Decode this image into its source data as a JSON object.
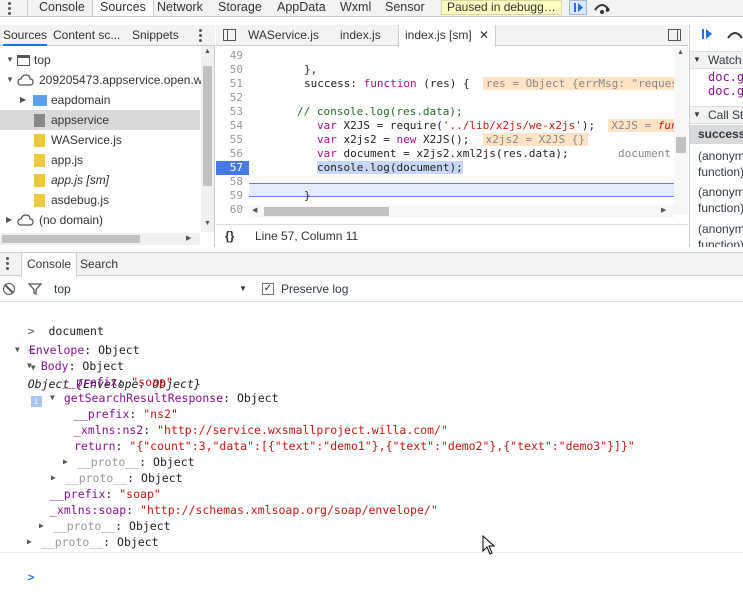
{
  "top_tabs": [
    "Console",
    "Sources",
    "Network",
    "Storage",
    "AppData",
    "Wxml",
    "Sensor"
  ],
  "active_top_tab": "Sources",
  "paused_label": "Paused in debugg…",
  "navigator": {
    "tabs": [
      "Sources",
      "Content sc...",
      "Snippets"
    ],
    "tree": [
      {
        "label": "top",
        "icon": "frame-icon"
      },
      {
        "label": "209205473.appservice.open.w",
        "icon": "cloud-icon"
      },
      {
        "label": "eapdomain",
        "icon": "folder-icon"
      },
      {
        "label": "appservice",
        "icon": "file-icon"
      },
      {
        "label": "WAService.js",
        "icon": "file-icon"
      },
      {
        "label": "app.js",
        "icon": "file-icon"
      },
      {
        "label": "app.js [sm]",
        "icon": "file-icon"
      },
      {
        "label": "asdebug.js",
        "icon": "file-icon"
      },
      {
        "label": "(no domain)",
        "icon": "cloud-icon"
      }
    ]
  },
  "editor": {
    "tabs": [
      "WAService.js",
      "index.js",
      "index.js [sm]"
    ],
    "active_tab": "index.js [sm]",
    "line_numbers": [
      "49",
      "50",
      "51",
      "52",
      "53",
      "54",
      "55",
      "56",
      "57",
      "58",
      "59",
      "60"
    ],
    "current_line": "57",
    "code": {
      "l50": "},",
      "l51_a": "success: ",
      "l51_kw": "function",
      "l51_b": " (res) {",
      "l51_val": "res = Object {errMsg: \"reques",
      "l53": "// console.log(res.data);",
      "l54_kw": "var",
      "l54_a": " X2JS = require(",
      "l54_str": "'../lib/x2js/we-x2js'",
      "l54_b": ");",
      "l54_val_a": "X2JS = ",
      "l54_val_b": "fun",
      "l55_kw": "var",
      "l55_a": " x2js2 = ",
      "l55_kw2": "new",
      "l55_b": " X2JS();",
      "l55_val": "x2js2 = X2JS {}",
      "l56_kw": "var",
      "l56_a": " document = x2js2.xml2js(res.data);",
      "l56_val": "document",
      "l57": "console.log(document);",
      "l59": "}"
    },
    "status": "Line 57, Column 11",
    "status_icon": "{}"
  },
  "debugger_sidebar": {
    "watch_label": "Watch",
    "watch_items": [
      "doc.ge",
      "doc.ge"
    ],
    "call_stack_label": "Call Sta",
    "frames": [
      "success",
      "(anonym",
      "function)",
      "(anonym",
      "function)",
      "(anonym",
      "function)"
    ]
  },
  "drawer": {
    "tabs": [
      "Console",
      "Search"
    ],
    "active_tab": "Console",
    "context": "top",
    "preserve_log": "Preserve log",
    "preserve_checked": true
  },
  "console": {
    "input_echo": "document",
    "lines": [
      {
        "text": "Object {Envelope: Object}",
        "type": "header"
      },
      {
        "key": "Envelope",
        "value": "Object"
      },
      {
        "key": "Body",
        "value": "Object"
      },
      {
        "key": "__prefix",
        "value": "\"soap\""
      },
      {
        "key": "getSearchResultResponse",
        "value": "Object"
      },
      {
        "key": "__prefix",
        "value": "\"ns2\""
      },
      {
        "key": "_xmlns:ns2",
        "value": "\"http://service.wxsmallproject.willa.com/\""
      },
      {
        "key": "return",
        "value": "\"{\"count\":3,\"data\":[{\"text\":\"demo1\"},{\"text\":\"demo2\"},{\"text\":\"demo3\"}]}\""
      },
      {
        "key": "__proto__",
        "value": "Object"
      },
      {
        "key": "__proto__",
        "value": "Object"
      },
      {
        "key": "__prefix",
        "value": "\"soap\""
      },
      {
        "key": "_xmlns:soap",
        "value": "\"http://schemas.xmlsoap.org/soap/envelope/\""
      },
      {
        "key": "__proto__",
        "value": "Object"
      },
      {
        "key": "__proto__",
        "value": "Object"
      }
    ]
  }
}
